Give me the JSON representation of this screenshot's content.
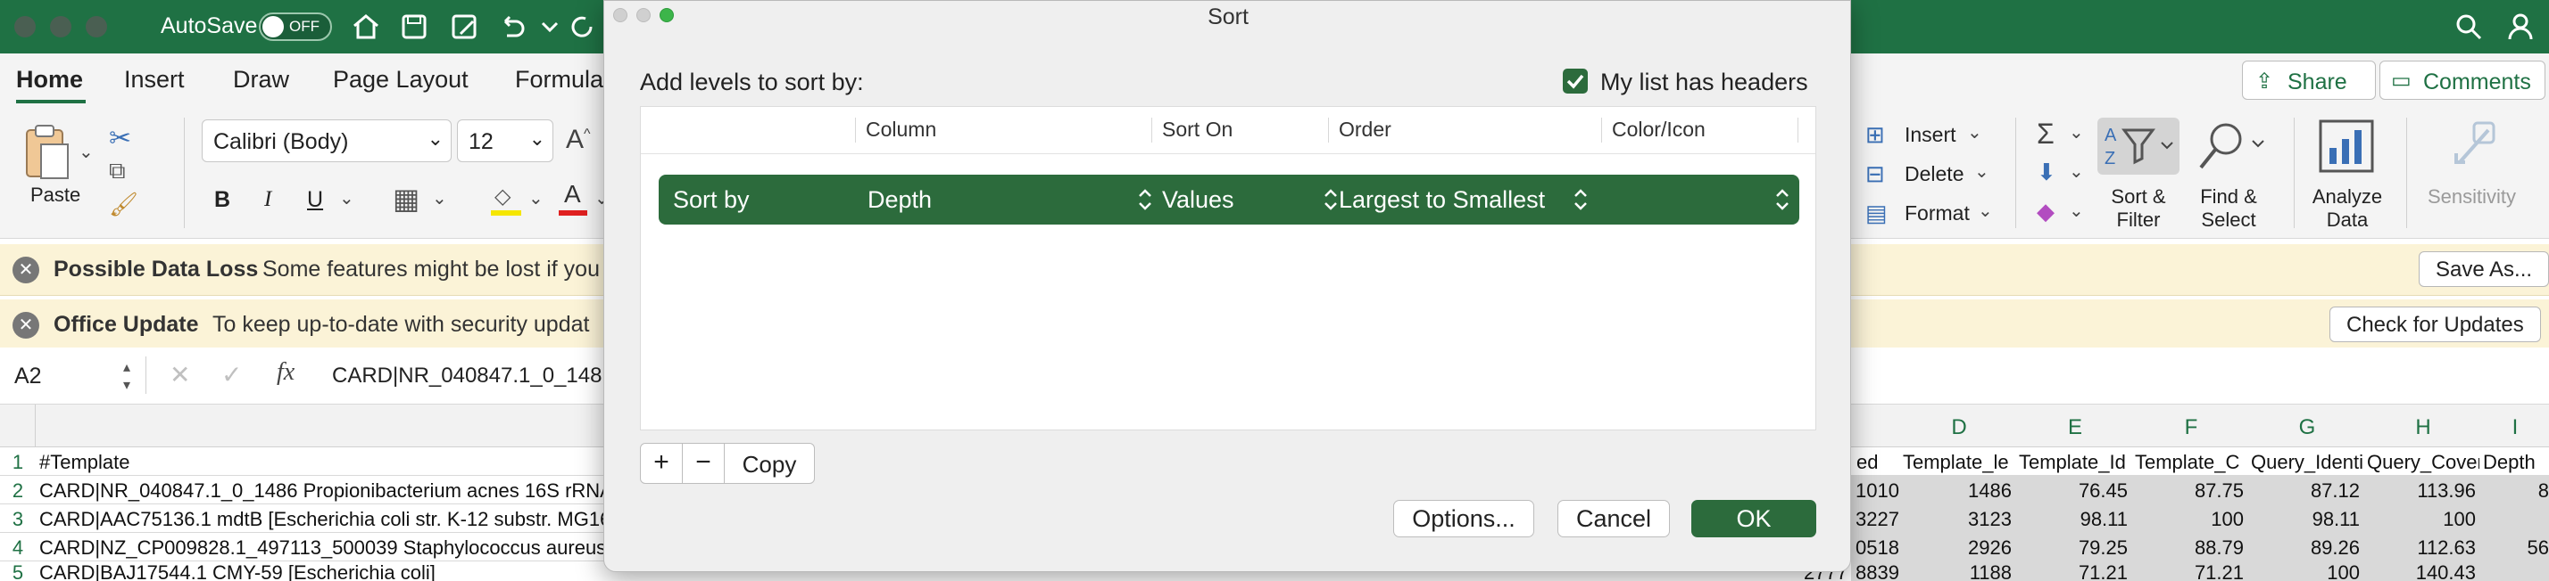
{
  "titlebar": {
    "autosave_label": "AutoSave",
    "toggle_state": "OFF"
  },
  "tabs": [
    "Home",
    "Insert",
    "Draw",
    "Page Layout",
    "Formula"
  ],
  "ribbon": {
    "paste_label": "Paste",
    "font_name": "Calibri (Body)",
    "font_size": "12",
    "bold": "B",
    "italic": "I",
    "underline": "U",
    "insert_label": "Insert",
    "delete_label": "Delete",
    "format_label": "Format",
    "sort_filter_line1": "Sort &",
    "sort_filter_line2": "Filter",
    "find_select_line1": "Find &",
    "find_select_line2": "Select",
    "analyze_line1": "Analyze",
    "analyze_line2": "Data",
    "sensitivity_label": "Sensitivity",
    "share_label": "Share",
    "comments_label": "Comments"
  },
  "infobars": {
    "dataloss_title": "Possible Data Loss",
    "dataloss_msg": "Some features might be lost if you",
    "dataloss_btn": "Save As...",
    "update_title": "Office Update",
    "update_msg": "To keep up-to-date with security updat",
    "update_btn": "Check for Updates"
  },
  "formula_bar": {
    "name_box": "A2",
    "fx": "fx",
    "formula": "CARD|NR_040847.1_0_148"
  },
  "grid": {
    "right_columns": [
      "D",
      "E",
      "F",
      "G",
      "H",
      "I"
    ],
    "row_numbers": [
      "1",
      "2",
      "3",
      "4",
      "5"
    ],
    "col_a": [
      "#Template",
      "CARD|NR_040847.1_0_1486 Propionibacterium acnes 16S rRNA",
      "CARD|AAC75136.1 mdtB [Escherichia coli str. K-12 substr. MG16",
      "CARD|NZ_CP009828.1_497113_500039 Staphylococcus aureus 2",
      "CARD|BAJ17544.1 CMY-59 [Escherichia coli]"
    ],
    "header_right": [
      "ed",
      "Template_le",
      "Template_Id",
      "Template_C",
      "Query_Identi",
      "Query_Cover",
      "Depth"
    ],
    "rows_right": [
      [
        "1010",
        "1486",
        "76.45",
        "87.75",
        "87.12",
        "113.96",
        "8"
      ],
      [
        "3227",
        "3123",
        "98.11",
        "100",
        "98.11",
        "100",
        ""
      ],
      [
        "0518",
        "2926",
        "79.25",
        "88.79",
        "89.26",
        "112.63",
        "56"
      ],
      [
        "8839",
        "1188",
        "71.21",
        "71.21",
        "100",
        "140.43",
        ""
      ]
    ],
    "row5_partial": "2777"
  },
  "dialog": {
    "title": "Sort",
    "add_levels_label": "Add levels to sort by:",
    "headers_checkbox_label": "My list has headers",
    "headers_checked": true,
    "columns": [
      "Column",
      "Sort On",
      "Order",
      "Color/Icon"
    ],
    "level": {
      "label": "Sort by",
      "column": "Depth",
      "sort_on": "Values",
      "order": "Largest to Smallest"
    },
    "add_btn": "+",
    "remove_btn": "−",
    "copy_btn": "Copy",
    "options_btn": "Options...",
    "cancel_btn": "Cancel",
    "ok_btn": "OK",
    "accent": "#2c6b3c"
  }
}
